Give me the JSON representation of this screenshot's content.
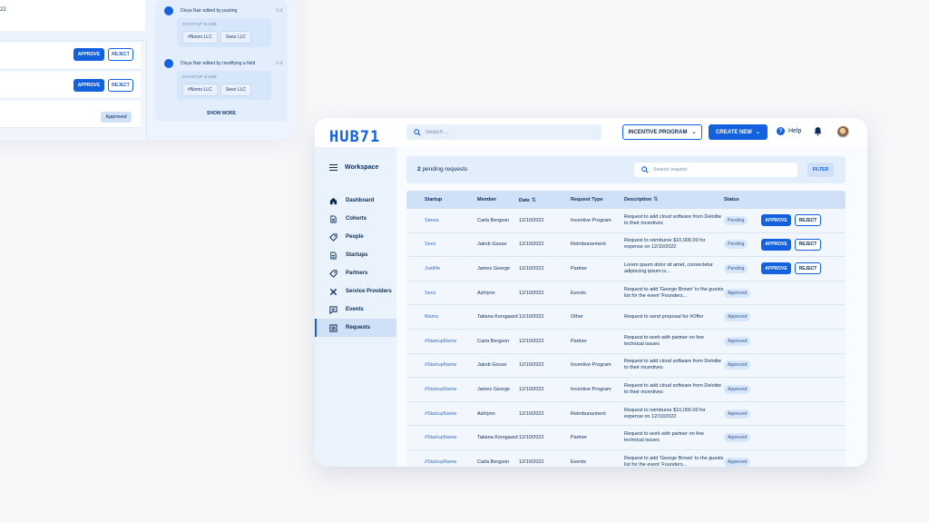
{
  "background": {
    "top_text": "22",
    "rows": [
      {
        "approve_label": "APPROVE",
        "reject_label": "REJECT"
      },
      {
        "approve_label": "APPROVE",
        "reject_label": "REJECT"
      },
      {
        "status": "Approved"
      }
    ],
    "activity": [
      {
        "text": "Divya Nair edited by pasting",
        "time": "1 d",
        "field_label": "STARTUP NAME",
        "from": "#Nomo LLC",
        "to": "Seez LLC"
      },
      {
        "text": "Divya Nair edited by modifying a field",
        "time": "1 d",
        "field_label": "STARTUP NAME",
        "from": "#Nomo LLC",
        "to": "Seez LLC"
      }
    ],
    "show_more": "SHOW MORE"
  },
  "topbar": {
    "logo": "HUB71",
    "search_placeholder": "Search ...",
    "incentive_program": "INCENTIVE PROGRAM",
    "create_new": "CREATE NEW",
    "help": "Help"
  },
  "sidebar": {
    "workspace": "Workspace",
    "items": [
      {
        "label": "Dashboard",
        "icon": "home-icon"
      },
      {
        "label": "Cohorts",
        "icon": "document-icon"
      },
      {
        "label": "People",
        "icon": "tag-icon"
      },
      {
        "label": "Startups",
        "icon": "document-icon"
      },
      {
        "label": "Partners",
        "icon": "tag-icon"
      },
      {
        "label": "Service Providers",
        "icon": "tools-icon"
      },
      {
        "label": "Events",
        "icon": "chat-icon"
      },
      {
        "label": "Requests",
        "icon": "list-icon"
      }
    ],
    "active": "Requests"
  },
  "requests": {
    "count": "2",
    "pending_label": "pending requests",
    "search_placeholder": "Search request",
    "filter": "FILTER",
    "columns": [
      "Startup",
      "Member",
      "Date",
      "Request Type",
      "Description",
      "Status"
    ],
    "rows": [
      {
        "startup": "Sarwa",
        "member": "Carla Bergson",
        "date": "12/10/2022",
        "type": "Incentive Program",
        "desc": "Request to add cloud software from Deloitte to their incentives",
        "status": "Pending",
        "approve": "APPROVE",
        "reject": "REJECT"
      },
      {
        "startup": "Seez",
        "member": "Jakob Gouse",
        "date": "12/10/2022",
        "type": "Reimbursement",
        "desc": "Request to reimburse $10,000.00 for expense on 12/10/2022",
        "status": "Pending",
        "approve": "APPROVE",
        "reject": "REJECT"
      },
      {
        "startup": "Justlife",
        "member": "James George",
        "date": "12/10/2022",
        "type": "Partner",
        "desc": "Lorem ipsum dolor sit amet, consectetur adipiscing ipsum is...",
        "status": "Pending",
        "approve": "APPROVE",
        "reject": "REJECT"
      },
      {
        "startup": "Seez",
        "member": "Ashlynn",
        "date": "12/10/2022",
        "type": "Events",
        "desc": "Request to add 'George Brown' to the guests list for the event 'Founders...",
        "status": "Approved"
      },
      {
        "startup": "Mamo",
        "member": "Tatiana Korsgaard",
        "date": "12/10/2022",
        "type": "Other",
        "desc": "Request to send proposal for #Offer",
        "status": "Approved"
      },
      {
        "startup": "#StartupName",
        "member": "Carla Bergson",
        "date": "12/10/2022",
        "type": "Partner",
        "desc": "Request to work with partner on few technical issues",
        "status": "Approved"
      },
      {
        "startup": "#StartupName",
        "member": "Jakob Gouse",
        "date": "12/10/2022",
        "type": "Incentive Program",
        "desc": "Request to add cloud software from Deloitte to their incentives",
        "status": "Approved"
      },
      {
        "startup": "#StartupName",
        "member": "James George",
        "date": "12/10/2022",
        "type": "Incentive Program",
        "desc": "Request to add cloud software from Deloitte to their incentives",
        "status": "Approved"
      },
      {
        "startup": "#StartupName",
        "member": "Ashlynn",
        "date": "12/10/2022",
        "type": "Reimbursement",
        "desc": "Request to reimburse $10,000.00 for expense on 12/10/2022",
        "status": "Approved"
      },
      {
        "startup": "#StartupName",
        "member": "Tatiana Korsgaard",
        "date": "12/10/2022",
        "type": "Partner",
        "desc": "Request to work with partner on few technical issues",
        "status": "Approved"
      },
      {
        "startup": "#StartupName",
        "member": "Carla Bergson",
        "date": "12/10/2022",
        "type": "Events",
        "desc": "Request to add 'George Brown' to the guests list for the event 'Founders...",
        "status": "Approved"
      }
    ]
  },
  "colors": {
    "accent": "#1461e0",
    "navy": "#0c2d57",
    "sidebar_bg": "#eaf2fc"
  }
}
